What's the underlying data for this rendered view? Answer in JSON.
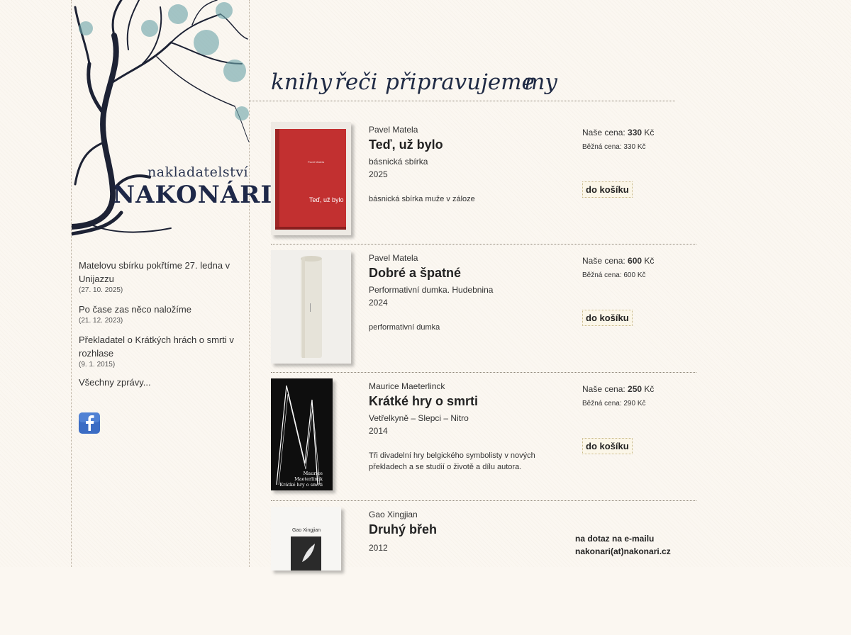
{
  "publisher": {
    "line1": "nakladatelství",
    "line2": "NAKONÁRI"
  },
  "nav": [
    "knihy",
    "řeči",
    "připravujeme",
    "my"
  ],
  "news": [
    {
      "title": "Matelovu sbírku pokřtíme 27. ledna v Unijazzu",
      "date": "(27. 10. 2025)"
    },
    {
      "title": "Po čase zas něco naložíme",
      "date": "(21. 12. 2023)"
    },
    {
      "title": "Překladatel o Krátkých hrách o smrti v rozhlase",
      "date": "(9. 1. 2015)"
    }
  ],
  "all_news": "Všechny zprávy...",
  "social_icon": "facebook-icon",
  "books": [
    {
      "author": "Pavel Matela",
      "title": "Teď, už bylo",
      "subtitle": "básnická sbírka",
      "year": "2025",
      "desc": "básnická sbírka muže v záloze",
      "price_label": "Naše cena:",
      "price": "330",
      "currency": "Kč",
      "regular": "Běžná cena: 330 Kč",
      "cart": "do košíku",
      "cover_text": "Teď, už bylo",
      "cover_author": "Pavel Matela"
    },
    {
      "author": "Pavel Matela",
      "title": "Dobré a špatné",
      "subtitle": "Performativní dumka. Hudebnina",
      "year": "2024",
      "desc": "performativní dumka",
      "price_label": "Naše cena:",
      "price": "600",
      "currency": "Kč",
      "regular": "Běžná cena: 600 Kč",
      "cart": "do košíku"
    },
    {
      "author": "Maurice Maeterlinck",
      "title": "Krátké hry o smrti",
      "subtitle": "Vetřelkyně – Slepci – Nitro",
      "year": "2014",
      "desc": "Tři divadelní hry belgického symbolisty v nových překladech a se studií o životě a dílu autora.",
      "price_label": "Naše cena:",
      "price": "250",
      "currency": "Kč",
      "regular": "Běžná cena: 290 Kč",
      "cart": "do košíku",
      "cover_lines": [
        "Maurice",
        "Maeterlinck",
        "Krátké hry o smrti"
      ]
    },
    {
      "author": "Gao Xingjian",
      "title": "Druhý břeh",
      "year": "2012",
      "contact_line1": "na dotaz na e-mailu",
      "contact_line2": "nakonari(at)nakonari.cz",
      "cover_author": "Gao Xingjian"
    }
  ]
}
